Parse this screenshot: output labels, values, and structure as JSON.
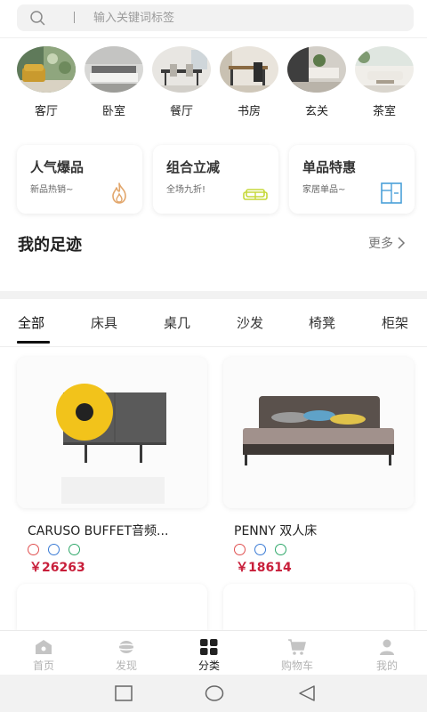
{
  "search": {
    "placeholder": "输入关键词标签"
  },
  "rooms": [
    {
      "label": "客厅"
    },
    {
      "label": "卧室"
    },
    {
      "label": "餐厅"
    },
    {
      "label": "书房"
    },
    {
      "label": "玄关"
    },
    {
      "label": "茶室"
    }
  ],
  "promos": [
    {
      "title": "人气爆品",
      "subtitle": "新品热销~",
      "icon": "flame-icon",
      "color": "#e2a66b"
    },
    {
      "title": "组合立减",
      "subtitle": "全场九折!",
      "icon": "sofa-icon",
      "color": "#c6d83a"
    },
    {
      "title": "单品特惠",
      "subtitle": "家居单品~",
      "icon": "cabinet-icon",
      "color": "#4aa0d8"
    }
  ],
  "footprint": {
    "title": "我的足迹",
    "more": "更多"
  },
  "tabs": [
    {
      "label": "全部",
      "active": true
    },
    {
      "label": "床具"
    },
    {
      "label": "桌几"
    },
    {
      "label": "沙发"
    },
    {
      "label": "椅凳"
    },
    {
      "label": "柜架"
    }
  ],
  "products": [
    {
      "name": "CARUSO BUFFET音频...",
      "price": "￥26263"
    },
    {
      "name": "PENNY 双人床",
      "price": "￥18614"
    }
  ],
  "bottom_nav": [
    {
      "label": "首页",
      "icon": "home-icon"
    },
    {
      "label": "发现",
      "icon": "planet-icon"
    },
    {
      "label": "分类",
      "icon": "grid-icon",
      "active": true
    },
    {
      "label": "购物车",
      "icon": "cart-icon"
    },
    {
      "label": "我的",
      "icon": "user-icon"
    }
  ],
  "colors": {
    "price": "#c81e3a",
    "active_text": "#111111",
    "inactive_nav": "#b3b3b3"
  }
}
